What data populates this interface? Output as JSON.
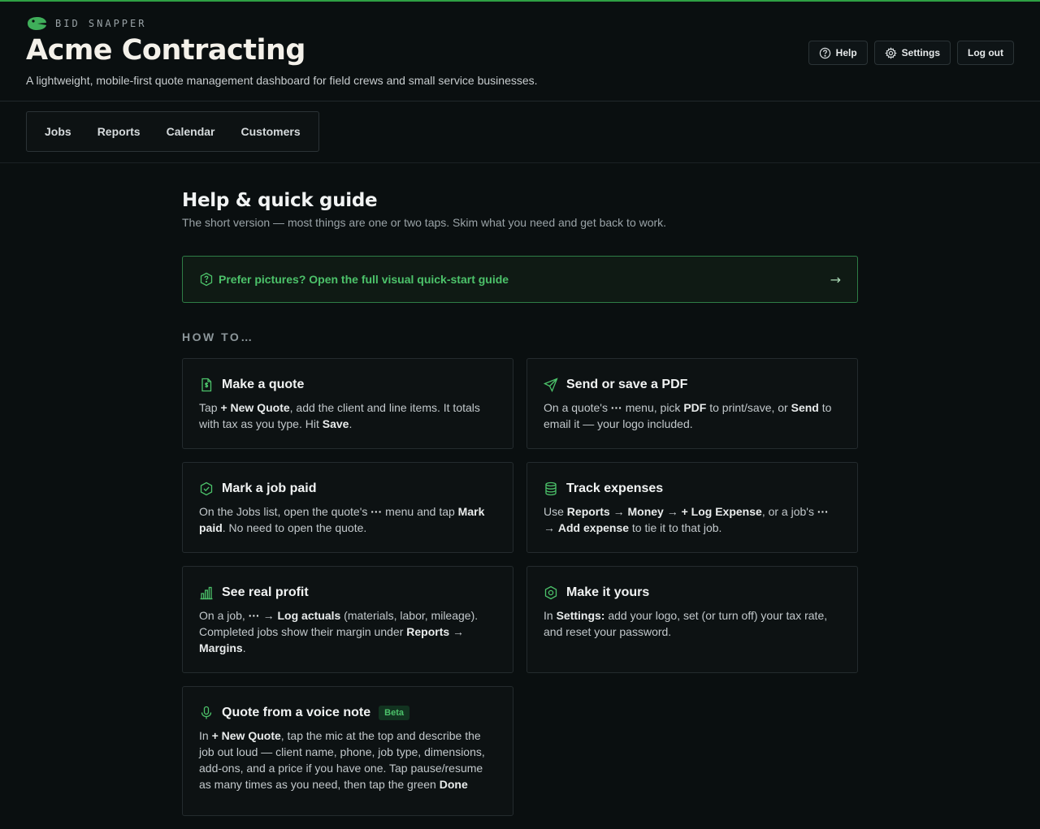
{
  "brand": {
    "name": "BID SNAPPER",
    "accent": "#2ea043"
  },
  "header": {
    "company": "Acme Contracting",
    "tagline": "A lightweight, mobile-first quote management dashboard for field crews and small service businesses.",
    "actions": {
      "help": "Help",
      "settings": "Settings",
      "logout": "Log out"
    }
  },
  "nav": {
    "tabs": [
      "Jobs",
      "Reports",
      "Calendar",
      "Customers"
    ]
  },
  "page": {
    "title": "Help & quick guide",
    "subtitle": "The short version — most things are one or two taps. Skim what you need and get back to work.",
    "banner": {
      "label": "Prefer pictures? Open the full visual quick-start guide",
      "arrow": "→"
    },
    "section_label": "HOW TO…"
  },
  "cards": [
    {
      "icon": "dollar-document-icon",
      "title": "Make a quote",
      "parts": [
        "Tap ",
        "+ New Quote",
        ", add the client and line items. It totals with tax as you type. Hit ",
        "Save",
        "."
      ]
    },
    {
      "icon": "send-icon",
      "title": "Send or save a PDF",
      "parts": [
        "On a quote's ",
        "···",
        " menu, pick ",
        "PDF",
        " to print/save, or ",
        "Send",
        " to email it — your logo included."
      ]
    },
    {
      "icon": "check-shield-icon",
      "title": "Mark a job paid",
      "parts": [
        "On the Jobs list, open the quote's ",
        "···",
        " menu and tap ",
        "Mark paid",
        ". No need to open the quote."
      ]
    },
    {
      "icon": "database-icon",
      "title": "Track expenses",
      "parts": [
        "Use ",
        "Reports",
        " → ",
        "Money",
        " → ",
        "+ Log Expense",
        ", or a job's ",
        "···",
        " → ",
        "Add expense",
        " to tie it to that job."
      ]
    },
    {
      "icon": "bar-chart-icon",
      "title": "See real profit",
      "parts": [
        "On a job, ",
        "···",
        " → ",
        "Log actuals",
        " (materials, labor, mileage). Completed jobs show their margin under ",
        "Reports",
        " → ",
        "Margins",
        "."
      ]
    },
    {
      "icon": "hexagon-gear-icon",
      "title": "Make it yours",
      "parts": [
        "In ",
        "Settings:",
        " add your logo, set (or turn off) your tax rate, and reset your password."
      ]
    },
    {
      "icon": "microphone-icon",
      "title": "Quote from a voice note",
      "badge": "Beta",
      "parts": [
        "In ",
        "+ New Quote",
        ", tap the mic at the top and describe the job out loud — client name, phone, job type, dimensions, add-ons, and a price if you have one. Tap pause/resume as many times as you need, then tap the green ",
        "Done"
      ]
    }
  ]
}
